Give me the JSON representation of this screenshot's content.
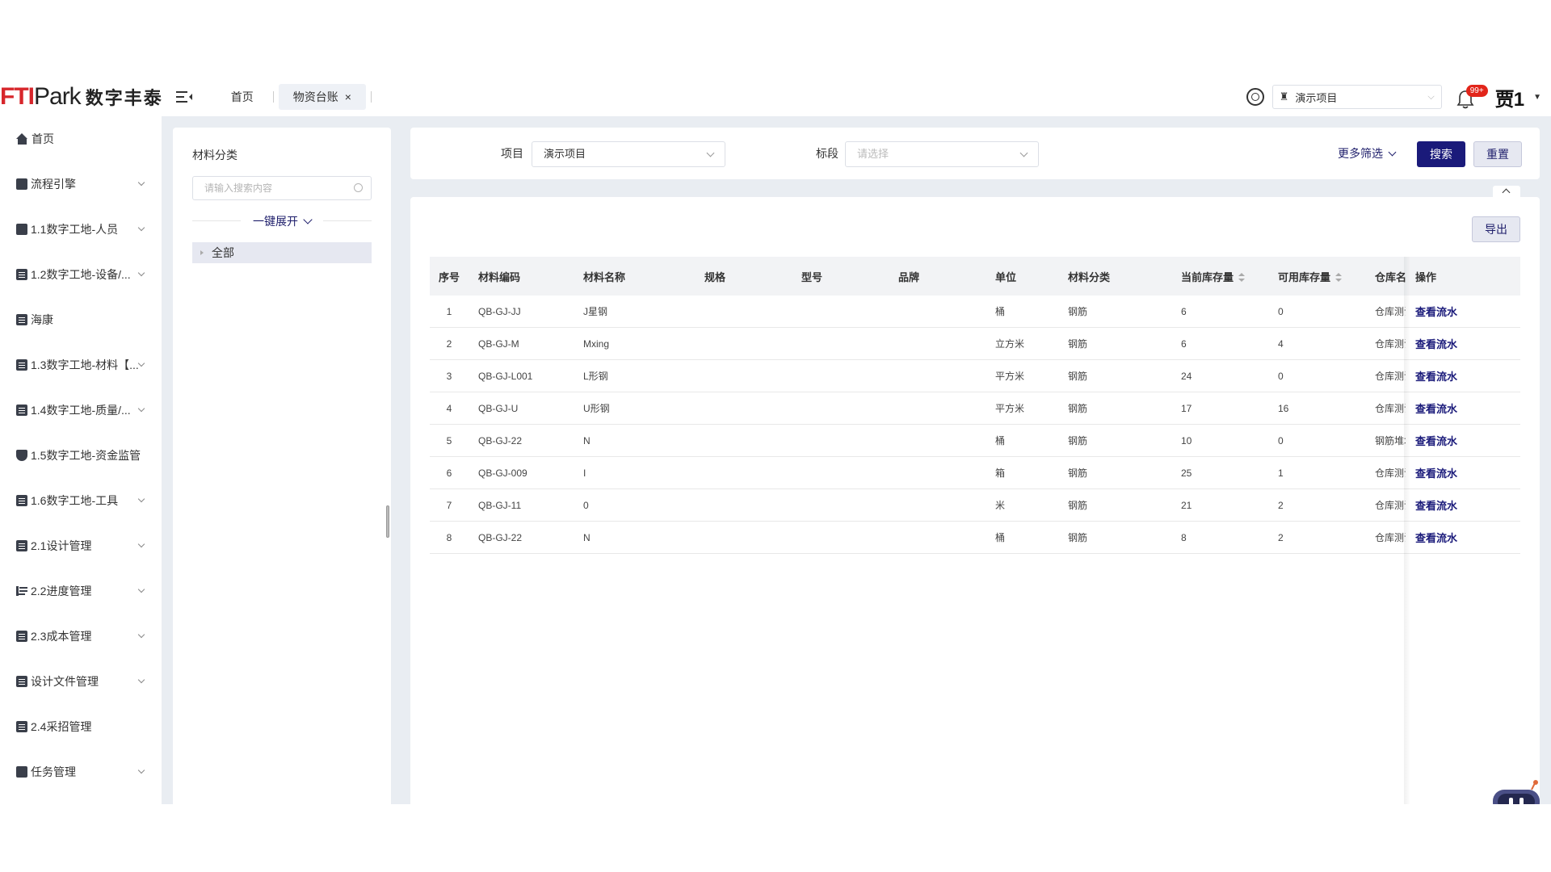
{
  "header": {
    "logo_ft": "FTI",
    "logo_park": "Park",
    "logo_cn": "数字丰泰",
    "tabs": [
      {
        "label": "首页"
      },
      {
        "label": "物资台账"
      }
    ],
    "close_symbol": "×",
    "project_select": "演示项目",
    "notification_badge": "99+",
    "username": "贾1"
  },
  "sidebar": {
    "items": [
      {
        "label": "首页",
        "icon": "home-icon"
      },
      {
        "label": "流程引擎",
        "icon": "flow-icon"
      },
      {
        "label": "1.1数字工地-人员",
        "icon": "people-icon"
      },
      {
        "label": "1.2数字工地-设备/...",
        "icon": "document-icon"
      },
      {
        "label": "海康",
        "icon": "document-icon"
      },
      {
        "label": "1.3数字工地-材料【...",
        "icon": "document-icon"
      },
      {
        "label": "1.4数字工地-质量/...",
        "icon": "document-icon"
      },
      {
        "label": "1.5数字工地-资金监管",
        "icon": "shield-icon"
      },
      {
        "label": "1.6数字工地-工具",
        "icon": "document-icon"
      },
      {
        "label": "2.1设计管理",
        "icon": "document-icon"
      },
      {
        "label": "2.2进度管理",
        "icon": "progress-icon"
      },
      {
        "label": "2.3成本管理",
        "icon": "document-icon"
      },
      {
        "label": "设计文件管理",
        "icon": "document-icon"
      },
      {
        "label": "2.4采招管理",
        "icon": "document-icon"
      },
      {
        "label": "任务管理",
        "icon": "briefcase-icon"
      }
    ]
  },
  "tree": {
    "title": "材料分类",
    "search_placeholder": "请输入搜索内容",
    "expand_all": "一键展开",
    "root_node": "全部"
  },
  "filters": {
    "project_label": "项目",
    "project_value": "演示项目",
    "section_label": "标段",
    "section_placeholder": "请选择",
    "more_filter": "更多筛选",
    "search_button": "搜索",
    "reset_button": "重置"
  },
  "table": {
    "export_button": "导出",
    "columns": [
      "序号",
      "材料编码",
      "材料名称",
      "规格",
      "型号",
      "品牌",
      "单位",
      "材料分类",
      "当前库存量",
      "可用库存量",
      "仓库名",
      "操作"
    ],
    "action_label": "查看流水",
    "rows": [
      {
        "no": "1",
        "code": "QB-GJ-JJ",
        "name": "J星钢",
        "spec": "",
        "model": "",
        "brand": "",
        "unit": "桶",
        "category": "钢筋",
        "current": "6",
        "available": "0",
        "warehouse": "仓库测试"
      },
      {
        "no": "2",
        "code": "QB-GJ-M",
        "name": "Mxing",
        "spec": "",
        "model": "",
        "brand": "",
        "unit": "立方米",
        "category": "钢筋",
        "current": "6",
        "available": "4",
        "warehouse": "仓库测试"
      },
      {
        "no": "3",
        "code": "QB-GJ-L001",
        "name": "L形钢",
        "spec": "",
        "model": "",
        "brand": "",
        "unit": "平方米",
        "category": "钢筋",
        "current": "24",
        "available": "0",
        "warehouse": "仓库测试"
      },
      {
        "no": "4",
        "code": "QB-GJ-U",
        "name": "U形钢",
        "spec": "",
        "model": "",
        "brand": "",
        "unit": "平方米",
        "category": "钢筋",
        "current": "17",
        "available": "16",
        "warehouse": "仓库测试"
      },
      {
        "no": "5",
        "code": "QB-GJ-22",
        "name": "N",
        "spec": "",
        "model": "",
        "brand": "",
        "unit": "桶",
        "category": "钢筋",
        "current": "10",
        "available": "0",
        "warehouse": "钢筋堆场"
      },
      {
        "no": "6",
        "code": "QB-GJ-009",
        "name": "I",
        "spec": "",
        "model": "",
        "brand": "",
        "unit": "箱",
        "category": "钢筋",
        "current": "25",
        "available": "1",
        "warehouse": "仓库测试"
      },
      {
        "no": "7",
        "code": "QB-GJ-11",
        "name": "0",
        "spec": "",
        "model": "",
        "brand": "",
        "unit": "米",
        "category": "钢筋",
        "current": "21",
        "available": "2",
        "warehouse": "仓库测试"
      },
      {
        "no": "8",
        "code": "QB-GJ-22",
        "name": "N",
        "spec": "",
        "model": "",
        "brand": "",
        "unit": "桶",
        "category": "钢筋",
        "current": "8",
        "available": "2",
        "warehouse": "仓库测试"
      }
    ]
  },
  "colors": {
    "primary": "#1a1a7a",
    "brand_red": "#d7262b",
    "badge_red": "#e2251a",
    "page_bg": "#e9edf2"
  }
}
